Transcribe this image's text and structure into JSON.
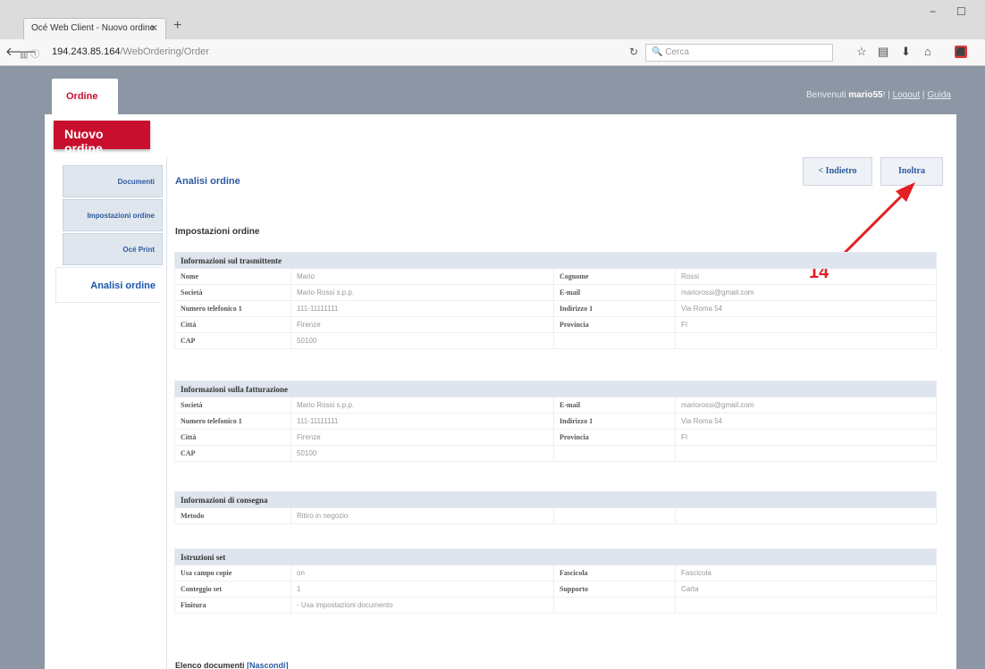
{
  "browser": {
    "tab_title": "Océ Web Client - Nuovo ordine",
    "new_tab": "+",
    "url_host": "194.243.85.164",
    "url_path": "/WebOrdering/Order",
    "search_placeholder": "Cerca"
  },
  "header": {
    "app_tab": "Ordine",
    "welcome_prefix": "Benvenuti",
    "username": "mario55",
    "logout": "Logout",
    "help": "Guida"
  },
  "page_button": "Nuovo ordine",
  "sidebar": {
    "items": [
      {
        "label": "Documenti"
      },
      {
        "label": "Impostazioni ordine"
      },
      {
        "label": "Océ Print"
      },
      {
        "label": "Analisi ordine"
      }
    ]
  },
  "content": {
    "title": "Analisi ordine",
    "back_button": "< Indietro",
    "forward_button": "Inoltra",
    "settings_title": "Impostazioni ordine",
    "annotation_number": "14"
  },
  "sender": {
    "header": "Informazioni sul trasmittente",
    "rows": [
      [
        "Nome",
        "Mario",
        "Cognome",
        "Rossi"
      ],
      [
        "Società",
        "Mario Rossi s.p.p.",
        "E-mail",
        "mariorossi@gmail.com"
      ],
      [
        "Numero telefonico 1",
        "111-11111111",
        "Indirizzo 1",
        "Via Roma 54"
      ],
      [
        "Città",
        "Firenze",
        "Provincia",
        "FI"
      ],
      [
        "CAP",
        "50100",
        "",
        ""
      ]
    ]
  },
  "billing": {
    "header": "Informazioni sulla fatturazione",
    "rows": [
      [
        "Società",
        "Mario Rossi s.p.p.",
        "E-mail",
        "mariorossi@gmail.com"
      ],
      [
        "Numero telefonico 1",
        "111-11111111",
        "Indirizzo 1",
        "Via Roma 54"
      ],
      [
        "Città",
        "Firenze",
        "Provincia",
        "FI"
      ],
      [
        "CAP",
        "50100",
        "",
        ""
      ]
    ]
  },
  "delivery": {
    "header": "Informazioni di consegna",
    "rows": [
      [
        "Metodo",
        "Ritiro in negozio",
        "",
        ""
      ]
    ]
  },
  "set": {
    "header": "Istruzioni set",
    "rows": [
      [
        "Usa campo copie",
        "on",
        "Fascicola",
        "Fascicola"
      ],
      [
        "Conteggio set",
        "1",
        "Supporto",
        "Carta"
      ],
      [
        "Finitura",
        "- Usa impostazioni documento",
        "",
        ""
      ]
    ]
  },
  "doclist": {
    "label": "Elenco documenti",
    "link": "[Nascondi]"
  }
}
